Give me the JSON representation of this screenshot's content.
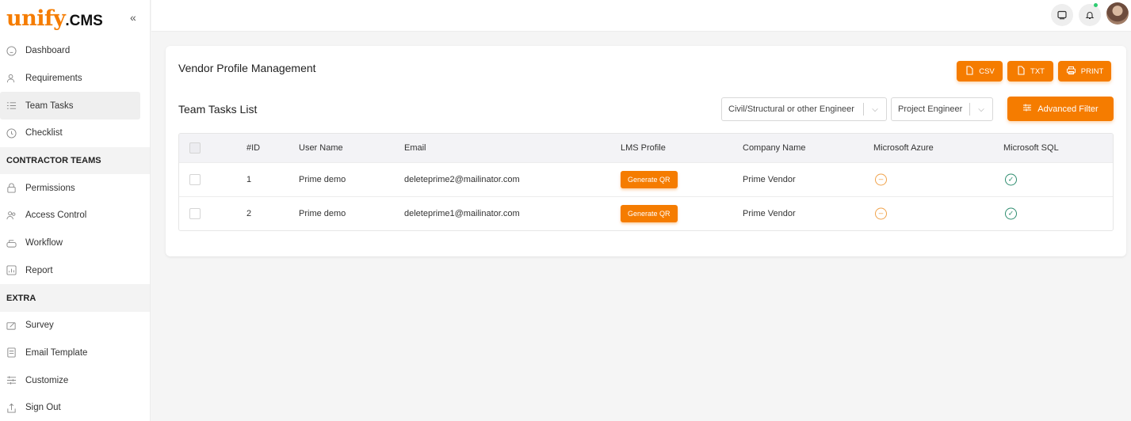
{
  "brand": {
    "logo_main": "unify",
    "logo_suffix": ".CMS"
  },
  "sidebar": {
    "collapse_icon": "double-chevron-left-icon",
    "items": [
      {
        "label": "Dashboard",
        "icon": "home-icon"
      },
      {
        "label": "Requirements",
        "icon": "users-icon"
      },
      {
        "label": "Team Tasks",
        "icon": "list-icon",
        "active": true
      },
      {
        "label": "Checklist",
        "icon": "clock-icon"
      }
    ],
    "section1": "CONTRACTOR TEAMS",
    "items2": [
      {
        "label": "Permissions",
        "icon": "lock-icon"
      },
      {
        "label": "Access Control",
        "icon": "user-group-icon"
      },
      {
        "label": "Workflow",
        "icon": "workflow-icon"
      },
      {
        "label": "Report",
        "icon": "chart-icon"
      }
    ],
    "section2": "EXTRA",
    "items3": [
      {
        "label": "Survey",
        "icon": "edit-icon"
      },
      {
        "label": "Email Template",
        "icon": "template-icon"
      },
      {
        "label": "Customize",
        "icon": "sliders-icon"
      },
      {
        "label": "Sign Out",
        "icon": "sign-out-icon"
      }
    ]
  },
  "page": {
    "title": "Vendor Profile Management",
    "list_title": "Team Tasks List",
    "export": {
      "csv": "CSV",
      "txt": "TXT",
      "print": "PRINT"
    },
    "filters": {
      "discipline": "Civil/Structural or other Engineer",
      "role": "Project Engineer"
    },
    "advanced_filter": "Advanced Filter"
  },
  "table": {
    "headers": {
      "id": "#ID",
      "user": "User Name",
      "email": "Email",
      "lms": "LMS Profile",
      "company": "Company Name",
      "azure": "Microsoft Azure",
      "sql": "Microsoft SQL"
    },
    "rows": [
      {
        "id": "1",
        "user": "Prime demo",
        "email": "deleteprime2@mailinator.com",
        "lms": "Generate QR",
        "company": "Prime Vendor",
        "azure": "minus-circle-icon",
        "sql": "check-circle-icon"
      },
      {
        "id": "2",
        "user": "Prime demo",
        "email": "deleteprime1@mailinator.com",
        "lms": "Generate QR",
        "company": "Prime Vendor",
        "azure": "minus-circle-icon",
        "sql": "check-circle-icon"
      }
    ]
  },
  "colors": {
    "accent": "#f57c00",
    "success": "#2d8c6e",
    "warning": "#f0a24a"
  }
}
